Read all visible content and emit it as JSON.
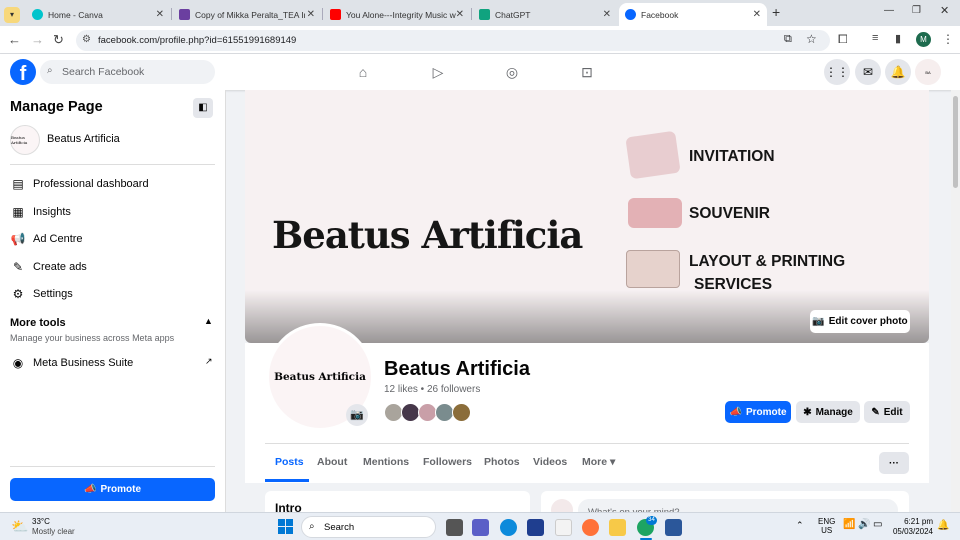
{
  "browser": {
    "tabs": [
      {
        "title": "Home - Canva",
        "color": "#00c4cc"
      },
      {
        "title": "Copy of Mikka Peralta_TEA Inte",
        "color": "#6b3fa0"
      },
      {
        "title": "You Alone---Integrity Music wi",
        "color": "#ff0000"
      },
      {
        "title": "ChatGPT",
        "color": "#10a37f"
      },
      {
        "title": "Facebook",
        "color": "#0866ff"
      }
    ],
    "url": "facebook.com/profile.php?id=61551991689149",
    "profile_initial": "M"
  },
  "fb": {
    "search_placeholder": "Search Facebook",
    "logo": "f"
  },
  "sidebar": {
    "title": "Manage Page",
    "page_name": "Beatus Artificia",
    "avatar_text": "Beatus Artificia",
    "items": [
      {
        "label": "Professional dashboard",
        "icon": "dashboard-icon"
      },
      {
        "label": "Insights",
        "icon": "insights-icon"
      },
      {
        "label": "Ad Centre",
        "icon": "megaphone-icon"
      },
      {
        "label": "Create ads",
        "icon": "edit-icon"
      },
      {
        "label": "Settings",
        "icon": "gear-icon"
      }
    ],
    "more_tools_title": "More tools",
    "more_tools_sub": "Manage your business across Meta apps",
    "meta_suite": "Meta Business Suite",
    "promote_label": "Promote"
  },
  "cover": {
    "brand": "Beatus Artificia",
    "services": [
      "INVITATION",
      "SOUVENIR",
      "LAYOUT & PRINTING",
      "SERVICES"
    ],
    "edit_cover": "Edit cover photo"
  },
  "profile": {
    "name": "Beatus Artificia",
    "stats": "12 likes • 26 followers",
    "avatar_text": "Beatus Artificia",
    "promote": "Promote",
    "manage": "Manage",
    "edit": "Edit"
  },
  "tabs": [
    "Posts",
    "About",
    "Mentions",
    "Followers",
    "Photos",
    "Videos",
    "More"
  ],
  "more_btn": "···",
  "intro_label": "Intro",
  "composer_placeholder": "What's on your mind?",
  "taskbar": {
    "weather_temp": "33°C",
    "weather_desc": "Mostly clear",
    "search": "Search",
    "lang1": "ENG",
    "lang2": "US",
    "time": "6:21 pm",
    "date": "05/03/2024",
    "badge": "34"
  }
}
